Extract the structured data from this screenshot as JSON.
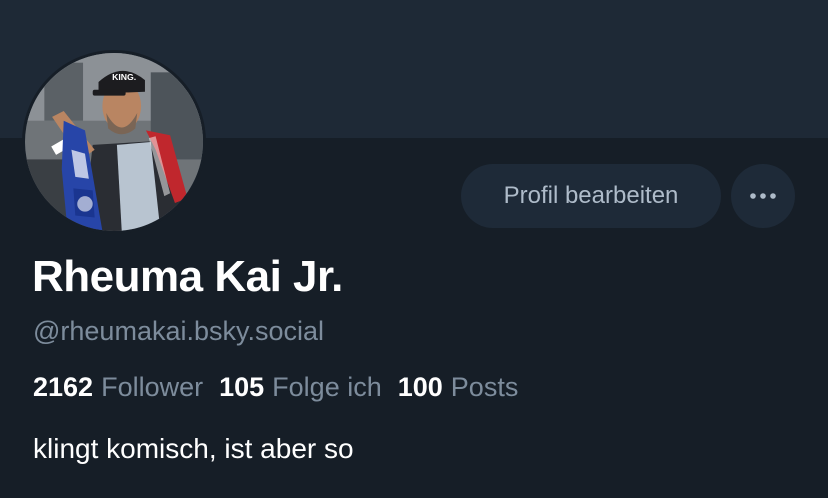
{
  "profile": {
    "display_name": "Rheuma Kai Jr.",
    "handle": "@rheumakai.bsky.social",
    "bio": "klingt komisch, ist aber so",
    "avatar_cap_text": "KING."
  },
  "actions": {
    "edit_label": "Profil bearbeiten",
    "more_icon": "ellipsis-icon"
  },
  "stats": [
    {
      "count": "2162",
      "label": "Follower"
    },
    {
      "count": "105",
      "label": "Folge ich"
    },
    {
      "count": "100",
      "label": "Posts"
    }
  ],
  "colors": {
    "background": "#161e27",
    "banner": "#1e2936",
    "button_bg": "#1e2a38",
    "muted_text": "#7d8c9c"
  }
}
